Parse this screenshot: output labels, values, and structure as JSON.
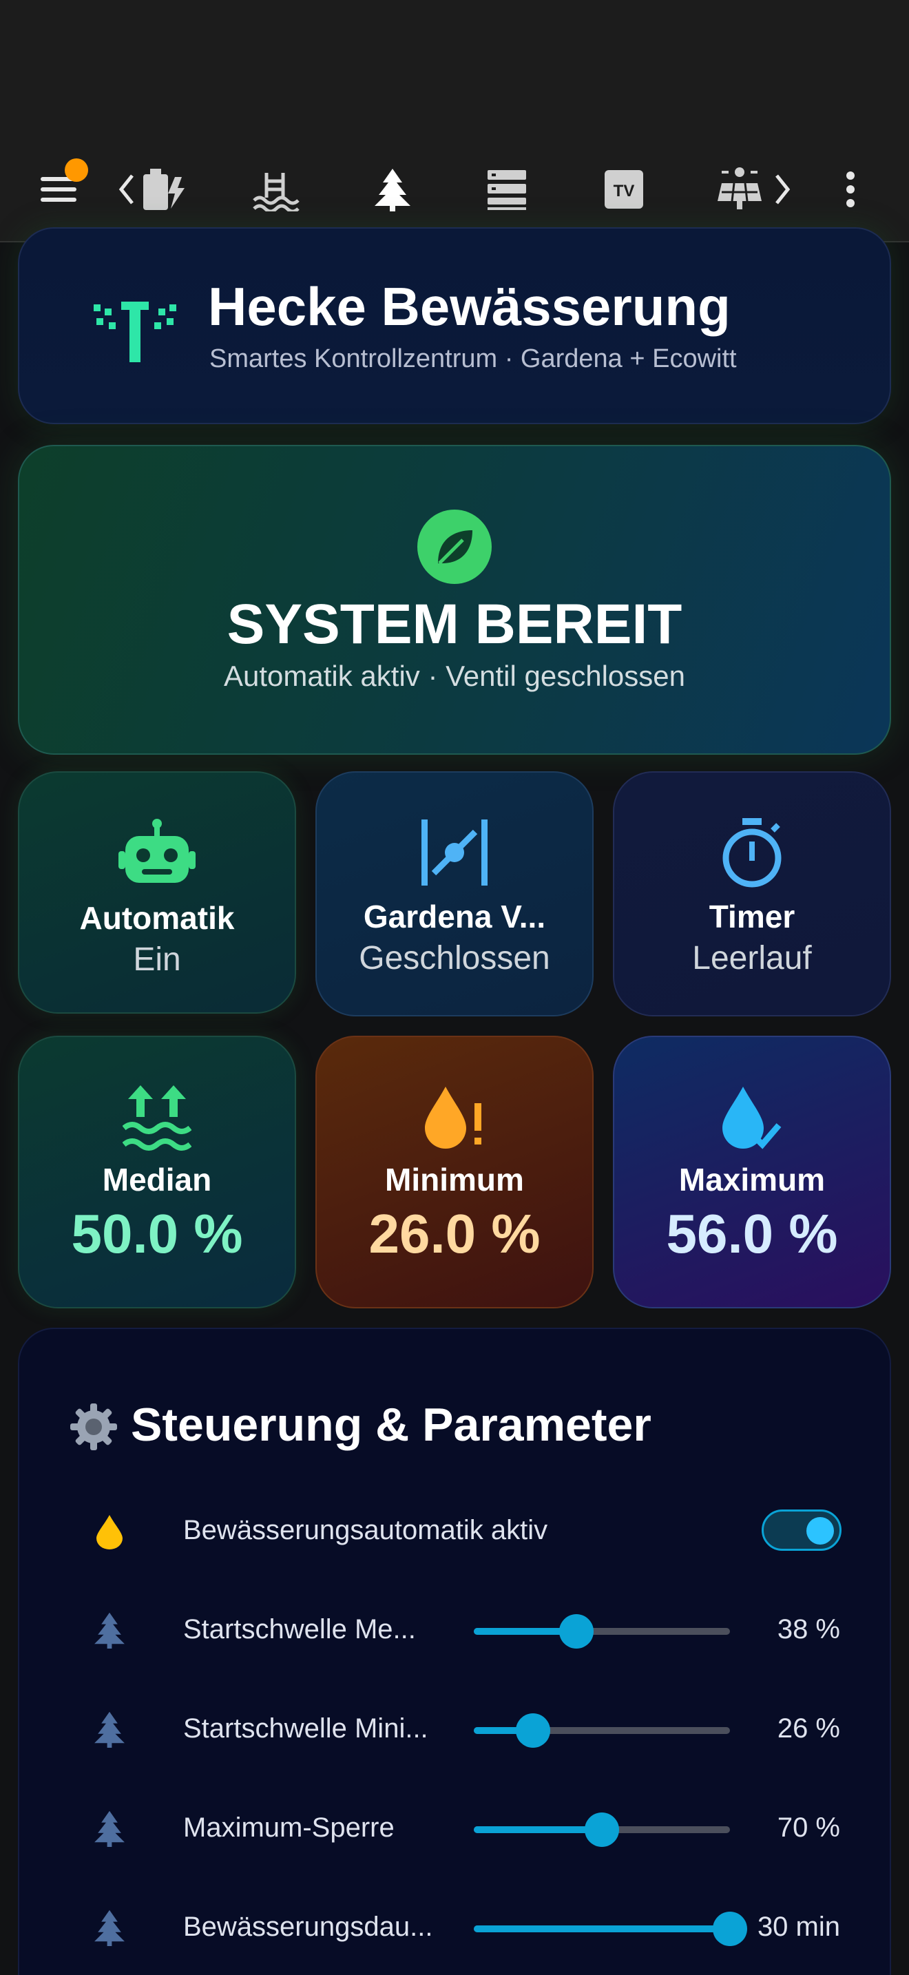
{
  "nav": {
    "tabs": [
      {
        "icon": "battery-charging-icon"
      },
      {
        "icon": "pool-icon"
      },
      {
        "icon": "pine-tree-icon",
        "selected": true
      },
      {
        "icon": "server-icon"
      },
      {
        "icon": "tv-icon"
      },
      {
        "icon": "solar-panel-icon"
      }
    ],
    "menu_badge_color": "#ff9800"
  },
  "header": {
    "title": "Hecke Bewässerung",
    "subtitle": "Smartes Kontrollzentrum · Gardena + Ecowitt",
    "icon": "sprinkler-icon"
  },
  "status": {
    "title": "SYSTEM BEREIT",
    "subtitle": "Automatik aktiv · Ventil geschlossen",
    "icon": "leaf-icon",
    "icon_color": "#3dd16a"
  },
  "tiles": [
    {
      "label": "Automatik",
      "value": "Ein",
      "icon": "robot-icon",
      "color": "#3ddc84"
    },
    {
      "label": "Gardena V...",
      "value": "Geschlossen",
      "icon": "valve-icon",
      "color": "#4fb3f6"
    },
    {
      "label": "Timer",
      "value": "Leerlauf",
      "icon": "timer-icon",
      "color": "#4fb3f6"
    }
  ],
  "moisture": [
    {
      "label": "Median",
      "value": "50.0 %",
      "icon": "water-level-up-icon",
      "color": "#7ef2c4"
    },
    {
      "label": "Minimum",
      "value": "26.0 %",
      "icon": "water-alert-icon",
      "color": "#ffd9a0"
    },
    {
      "label": "Maximum",
      "value": "56.0 %",
      "icon": "water-check-icon",
      "color": "#d6ecff"
    }
  ],
  "params": {
    "title": "Steuerung & Parameter",
    "icon": "gear-icon",
    "toggle_row": {
      "label": "Bewässerungsautomatik aktiv",
      "checked": true
    },
    "sliders": [
      {
        "label": "Startschwelle Me...",
        "value": "38 %",
        "fraction": 0.4
      },
      {
        "label": "Startschwelle Mini...",
        "value": "26 %",
        "fraction": 0.23
      },
      {
        "label": "Maximum-Sperre",
        "value": "70 %",
        "fraction": 0.5
      },
      {
        "label": "Bewässerungsdau...",
        "value": "30 min",
        "fraction": 1.0
      }
    ]
  }
}
